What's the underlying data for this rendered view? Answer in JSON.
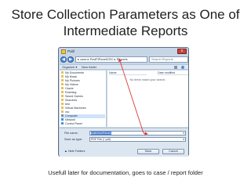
{
  "slide": {
    "title_line1": "Store Collection Parameters as One of",
    "title_line2": "Intermediate Reports",
    "caption": "Usefull later for documentation, goes to case / report folder"
  },
  "dialog": {
    "title": "Publ",
    "close": "x",
    "back": "◀",
    "forward": "▶",
    "address": "▸ case ▸ RedPiPanelDSC ▸ Reports",
    "search_placeholder": "Search Reports",
    "toolbar": {
      "organize": "Organize ▾",
      "new_folder": "New folder"
    },
    "nav_items": [
      {
        "label": "My Documents",
        "icon_color": "#e7c15a"
      },
      {
        "label": "My Music",
        "icon_color": "#e7c15a"
      },
      {
        "label": "My Pictures",
        "icon_color": "#e7c15a"
      },
      {
        "label": "My Videos",
        "icon_color": "#e7c15a"
      },
      {
        "label": "Oracle",
        "icon_color": "#e7c15a"
      },
      {
        "label": "Roaming",
        "icon_color": "#e7c15a"
      },
      {
        "label": "Saved Games",
        "icon_color": "#e7c15a"
      },
      {
        "label": "Searches",
        "icon_color": "#e7c15a"
      },
      {
        "label": "test",
        "icon_color": "#e7c15a"
      },
      {
        "label": "Virtual Machines",
        "icon_color": "#e7c15a"
      },
      {
        "label": "vsc",
        "icon_color": "#e7c15a"
      },
      {
        "label": "Computer",
        "icon_color": "#7a8fa8",
        "selected": true
      },
      {
        "label": "Network",
        "icon_color": "#4f8fd1"
      },
      {
        "label": "Control Panel",
        "icon_color": "#4f8fd1"
      }
    ],
    "columns": {
      "name": "Name",
      "date": "Date modified"
    },
    "empty_message": "No items match your search.",
    "file_name_label": "File name:",
    "file_name_value": "collectionParam",
    "save_type_label": "Save as type:",
    "save_type_value": "PDF File (*.pdf)",
    "hide_folders": "▲ Hide Folders",
    "save_button": "Save",
    "cancel_button": "Cancel",
    "arrow_color": "#d93a3a"
  }
}
